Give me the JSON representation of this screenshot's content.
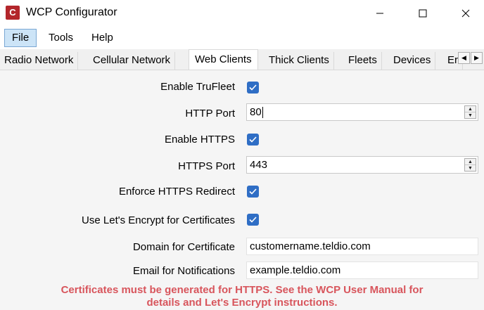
{
  "window": {
    "title": "WCP Configurator",
    "app_icon_letter": "C",
    "minimize_icon": "minimize-icon",
    "maximize_icon": "maximize-icon",
    "close_icon": "close-icon"
  },
  "menu": {
    "items": [
      {
        "label": "File"
      },
      {
        "label": "Tools"
      },
      {
        "label": "Help"
      }
    ]
  },
  "tabs": {
    "items": [
      {
        "label": "Radio Network"
      },
      {
        "label": "Cellular Network"
      },
      {
        "label": "Web Clients",
        "active": true
      },
      {
        "label": "Thick Clients"
      },
      {
        "label": "Fleets"
      },
      {
        "label": "Devices"
      },
      {
        "label": "Er"
      }
    ],
    "scroll_left": "◀",
    "scroll_right": "▶"
  },
  "form": {
    "enable_trufleet": {
      "label": "Enable TruFleet",
      "checked": true
    },
    "http_port": {
      "label": "HTTP Port",
      "value": "80"
    },
    "enable_https": {
      "label": "Enable HTTPS",
      "checked": true
    },
    "https_port": {
      "label": "HTTPS Port",
      "value": "443"
    },
    "enforce_https_redirect": {
      "label": "Enforce HTTPS Redirect",
      "checked": true
    },
    "use_lets_encrypt": {
      "label": "Use Let's Encrypt for Certificates",
      "checked": true
    },
    "domain": {
      "label": "Domain for Certificate",
      "value": "customername.teldio.com"
    },
    "email": {
      "label": "Email for Notifications",
      "value": "example.teldio.com"
    }
  },
  "warning": {
    "line1": "Certificates must be generated for HTTPS. See the WCP User Manual for",
    "line2": "details and Let's Encrypt instructions."
  },
  "colors": {
    "accent": "#2f6ec5",
    "warning": "#d8555c",
    "app_icon": "#b3262b"
  }
}
